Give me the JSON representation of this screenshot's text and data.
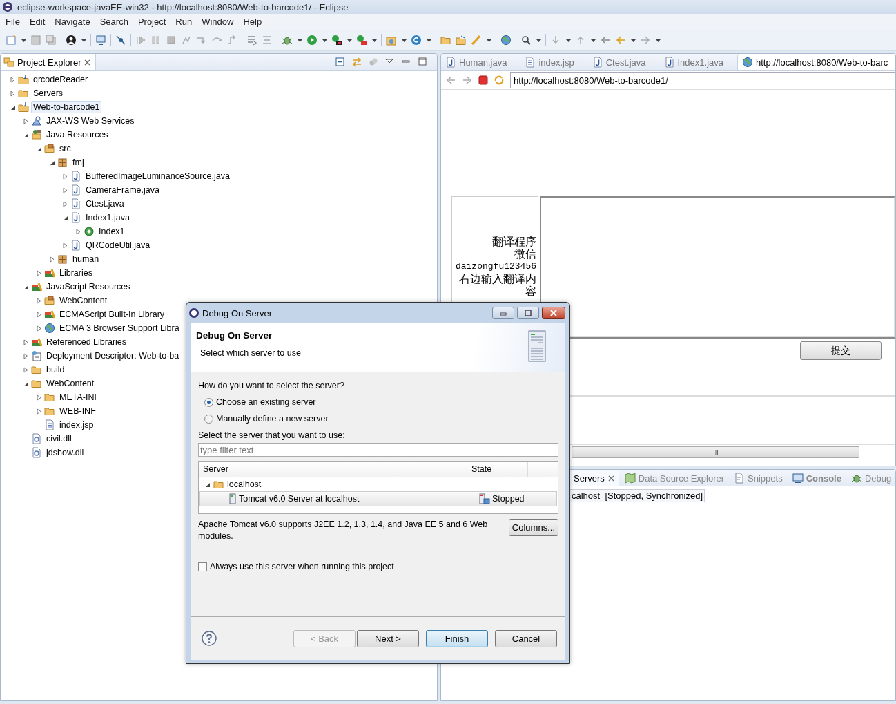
{
  "window": {
    "title": "eclipse-workspace-javaEE-win32 - http://localhost:8080/Web-to-barcode1/ - Eclipse"
  },
  "menu": [
    "File",
    "Edit",
    "Navigate",
    "Search",
    "Project",
    "Run",
    "Window",
    "Help"
  ],
  "project_explorer": {
    "title": "Project Explorer",
    "tree": [
      {
        "label": "qrcodeReader",
        "kind": "project",
        "expanded": false,
        "selected": false
      },
      {
        "label": "Servers",
        "kind": "folder",
        "expanded": false,
        "selected": false
      },
      {
        "label": "Web-to-barcode1",
        "kind": "project",
        "expanded": true,
        "selected": true,
        "children": [
          {
            "label": "JAX-WS Web Services",
            "kind": "webservice",
            "expanded": false,
            "selected": false
          },
          {
            "label": "Java Resources",
            "kind": "resources",
            "expanded": true,
            "selected": false,
            "children": [
              {
                "label": "src",
                "kind": "source",
                "expanded": true,
                "selected": false,
                "children": [
                  {
                    "label": "fmj",
                    "kind": "package",
                    "expanded": true,
                    "selected": false,
                    "children": [
                      {
                        "label": "BufferedImageLuminanceSource.java",
                        "kind": "java",
                        "expanded": false,
                        "selected": false
                      },
                      {
                        "label": "CameraFrame.java",
                        "kind": "java",
                        "expanded": false,
                        "selected": false
                      },
                      {
                        "label": "Ctest.java",
                        "kind": "java",
                        "expanded": false,
                        "selected": false
                      },
                      {
                        "label": "Index1.java",
                        "kind": "java",
                        "expanded": true,
                        "selected": false,
                        "children": [
                          {
                            "label": "Index1",
                            "kind": "class",
                            "expanded": false,
                            "selected": false
                          }
                        ]
                      },
                      {
                        "label": "QRCodeUtil.java",
                        "kind": "java",
                        "expanded": false,
                        "selected": false
                      }
                    ]
                  },
                  {
                    "label": "human",
                    "kind": "package",
                    "expanded": false,
                    "selected": false
                  }
                ]
              },
              {
                "label": "Libraries",
                "kind": "library",
                "expanded": false,
                "selected": false
              }
            ]
          },
          {
            "label": "JavaScript Resources",
            "kind": "library",
            "expanded": true,
            "selected": false,
            "children": [
              {
                "label": "WebContent",
                "kind": "source",
                "expanded": false,
                "selected": false
              },
              {
                "label": "ECMAScript Built-In Library",
                "kind": "library",
                "expanded": false,
                "selected": false
              },
              {
                "label": "ECMA 3 Browser Support Libra",
                "kind": "globe",
                "expanded": false,
                "selected": false
              }
            ]
          },
          {
            "label": "Referenced Libraries",
            "kind": "library",
            "expanded": false,
            "selected": false
          },
          {
            "label": "Deployment Descriptor: Web-to-ba",
            "kind": "descriptor",
            "expanded": false,
            "selected": false
          },
          {
            "label": "build",
            "kind": "folder",
            "expanded": false,
            "selected": false
          },
          {
            "label": "WebContent",
            "kind": "folder",
            "expanded": true,
            "selected": false,
            "children": [
              {
                "label": "META-INF",
                "kind": "folder",
                "expanded": false,
                "selected": false
              },
              {
                "label": "WEB-INF",
                "kind": "folder",
                "expanded": false,
                "selected": false
              },
              {
                "label": "index.jsp",
                "kind": "jsp",
                "selected": false
              }
            ]
          },
          {
            "label": "civil.dll",
            "kind": "dll",
            "selected": false
          },
          {
            "label": "jdshow.dll",
            "kind": "dll",
            "selected": false
          }
        ]
      }
    ]
  },
  "editor_tabs": [
    {
      "label": "Human.java",
      "kind": "java",
      "selected": false
    },
    {
      "label": "index.jsp",
      "kind": "jsp",
      "selected": false
    },
    {
      "label": "Ctest.java",
      "kind": "java",
      "selected": false
    },
    {
      "label": "Index1.java",
      "kind": "java",
      "selected": false
    },
    {
      "label": "http://localhost:8080/Web-to-barc",
      "kind": "browser",
      "selected": true
    }
  ],
  "browser": {
    "url": "http://localhost:8080/Web-to-barcode1/",
    "page": {
      "label_lines": [
        "翻译程序",
        "微信",
        "daizongfu123456",
        "右边输入翻译内",
        "容"
      ],
      "submit": "提交"
    }
  },
  "bottom_panel": {
    "tabs": [
      {
        "label": "Servers",
        "selected": true,
        "bold": false
      },
      {
        "label": "Data Source Explorer",
        "kind": "datasource",
        "selected": false,
        "bold": false
      },
      {
        "label": "Snippets",
        "kind": "snippets",
        "selected": false,
        "bold": false
      },
      {
        "label": "Console",
        "kind": "console",
        "selected": false,
        "bold": true
      },
      {
        "label": "Debug",
        "kind": "debug",
        "selected": false,
        "bold": false
      }
    ],
    "rows": [
      "calhost  [Stopped, Synchronized]"
    ]
  },
  "dialog": {
    "title": "Debug On Server",
    "heading": "Debug On Server",
    "subtitle": "Select which server to use",
    "question": "How do you want to select the server?",
    "radios": [
      {
        "label": "Choose an existing server",
        "selected": true
      },
      {
        "label": "Manually define a new server",
        "selected": false
      }
    ],
    "list_label": "Select the server that you want to use:",
    "filter": {
      "placeholder": "type filter text"
    },
    "columns": [
      "Server",
      "State"
    ],
    "servers": [
      {
        "label": "localhost",
        "expanded": true,
        "children": [
          {
            "label": "Tomcat v6.0 Server at localhost",
            "state": "Stopped",
            "selected": true
          }
        ]
      }
    ],
    "description": "Apache Tomcat v6.0 supports J2EE 1.2, 1.3, 1.4, and Java EE 5 and 6 Web modules.",
    "columns_button": "Columns...",
    "checkbox": {
      "label": "Always use this server when running this project",
      "checked": false
    },
    "buttons": [
      {
        "label": "< Back",
        "disabled": true,
        "default": false
      },
      {
        "label": "Next >",
        "disabled": false,
        "default": false
      },
      {
        "label": "Finish",
        "disabled": false,
        "default": true
      },
      {
        "label": "Cancel",
        "disabled": false,
        "default": false
      }
    ]
  }
}
